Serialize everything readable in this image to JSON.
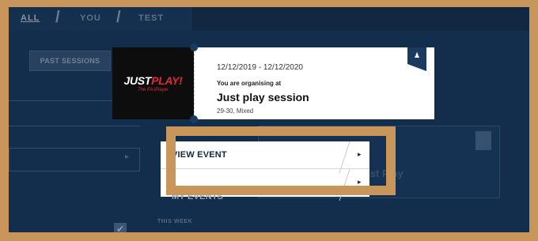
{
  "tabs": [
    {
      "label": "ALL",
      "active": true
    },
    {
      "label": "YOU",
      "active": false
    },
    {
      "label": "TEST",
      "active": false
    }
  ],
  "sidebar": {
    "past_sessions_label": "PAST SESSIONS",
    "this_week_label": "THIS WEEK",
    "checkbox_glyph": "✔"
  },
  "background_card": {
    "text": "Britain Club New Just Play"
  },
  "session_card": {
    "logo_text_white": "JUST",
    "logo_text_red": "PLAY!",
    "logo_sub": "The FA iPlayer",
    "dates": "12/12/2019 - 12/12/2020",
    "organising": "You are organising at",
    "title": "Just play session",
    "meta": "29-30, Mixed",
    "corner_icon": "people-icon"
  },
  "menu": {
    "items": [
      {
        "label": "VIEW EVENT",
        "arrow": "▸"
      },
      {
        "label": "MY EVENTS",
        "arrow": "▸"
      }
    ]
  },
  "colors": {
    "background_navy": "#1a3a5f",
    "highlight_gold": "#c8965a",
    "logo_red": "#e0283a"
  }
}
